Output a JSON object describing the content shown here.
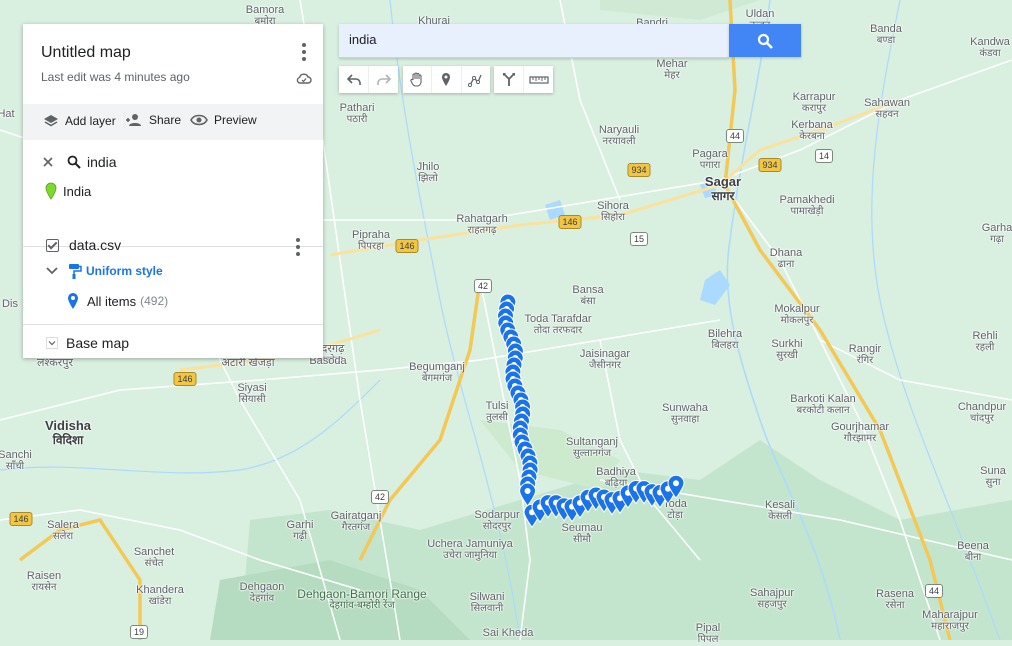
{
  "map": {
    "places": [
      {
        "name": "Bamora",
        "native": "बमोरा"
      },
      {
        "name": "Khurai",
        "native": ""
      },
      {
        "name": "Bandri",
        "native": ""
      },
      {
        "name": "Uldan",
        "native": "उल्दन"
      },
      {
        "name": "Banda",
        "native": "बण्डा"
      },
      {
        "name": "Kandwa",
        "native": "कंडवा"
      },
      {
        "name": "Mehar",
        "native": "मेहर"
      },
      {
        "name": "Karrapur",
        "native": "करापुर"
      },
      {
        "name": "Sahawan",
        "native": "सहवन"
      },
      {
        "name": "Kerbana",
        "native": "केरबना"
      },
      {
        "name": "Pathari",
        "native": "पठारी"
      },
      {
        "name": "Naryauli",
        "native": "नरयावली"
      },
      {
        "name": "Pagara",
        "native": "पगारा"
      },
      {
        "name": "Sagar",
        "native": "सागर"
      },
      {
        "name": "Jhilo",
        "native": "झिलो"
      },
      {
        "name": "Pamakhedi",
        "native": "पामाखेड़ी"
      },
      {
        "name": "Sihora",
        "native": "सिहोरा"
      },
      {
        "name": "Rahatgarh",
        "native": "राहतगढ़"
      },
      {
        "name": "Garha",
        "native": "गढ़ा"
      },
      {
        "name": "Piprahа",
        "native": "पिपरहा"
      },
      {
        "name": "Dhana",
        "native": "ढाना"
      },
      {
        "name": "Bansa",
        "native": "बंसा"
      },
      {
        "name": "Toda Tarafdar",
        "native": "तोदा तरफदार"
      },
      {
        "name": "Mokalpur",
        "native": "मोकलपुर"
      },
      {
        "name": "Bilehra",
        "native": "बिलहरा"
      },
      {
        "name": "Rehli",
        "native": "रहली"
      },
      {
        "name": "Jaisinagar",
        "native": "जैसीनगर"
      },
      {
        "name": "Surkhi",
        "native": "सुरखी"
      },
      {
        "name": "Rangir",
        "native": "रंगिर"
      },
      {
        "name": "Begumganj",
        "native": "बेगमगंज"
      },
      {
        "name": "Basoda",
        "native": "बासोदा"
      },
      {
        "name": "Siyasi",
        "native": "सियासी"
      },
      {
        "name": "Barkoti Kalan",
        "native": "बरकोटी कलान"
      },
      {
        "name": "Chandpur",
        "native": "चांदपुर"
      },
      {
        "name": "Sunwaha",
        "native": "सुनवाहा"
      },
      {
        "name": "Vidisha",
        "native": "विदिशा"
      },
      {
        "name": "Tulsi",
        "native": "तुलसी"
      },
      {
        "name": "Gourjhamar",
        "native": "गौरझामर"
      },
      {
        "name": "Sultanganj",
        "native": "सुल्तानगंज"
      },
      {
        "name": "Suna",
        "native": "सुना"
      },
      {
        "name": "Sanchi",
        "native": "साँची"
      },
      {
        "name": "Badhiya",
        "native": "बढ़िया"
      },
      {
        "name": "Kesali",
        "native": "केसली"
      },
      {
        "name": "Salera",
        "native": "सलेरा"
      },
      {
        "name": "Garhi",
        "native": "गढ़ी"
      },
      {
        "name": "Gairatganj",
        "native": "गैरतगंज"
      },
      {
        "name": "Sodarpur",
        "native": "सोदरपुर"
      },
      {
        "name": "Seumau",
        "native": "सीमौ"
      },
      {
        "name": "Toda",
        "native": "टोड़ा"
      },
      {
        "name": "Sanchet",
        "native": "संचेत"
      },
      {
        "name": "Uchera Jamuniya",
        "native": "उचेरा जामुनिया"
      },
      {
        "name": "Beena",
        "native": "बीना"
      },
      {
        "name": "Raisen",
        "native": "रायसेन"
      },
      {
        "name": "Khandera",
        "native": "खांडेरा"
      },
      {
        "name": "Dehgaon",
        "native": "देहगांव"
      },
      {
        "name": "Sahajpur",
        "native": "सहजपुर"
      },
      {
        "name": "Rasena",
        "native": "रसेना"
      },
      {
        "name": "Dehgaon-Bamori Range",
        "native": "देहगांव-बम्होरी रेंज"
      },
      {
        "name": "Silwani",
        "native": "सिलवानी"
      },
      {
        "name": "Maharajpur",
        "native": "महाराजपुर"
      },
      {
        "name": "Sai Kheda",
        "native": ""
      },
      {
        "name": "Pipal",
        "native": "पिपल"
      },
      {
        "name": "Atari Khejda",
        "native": "अटारी खेजड़ा"
      },
      {
        "name": "Lashkarpur",
        "native": "लश्करपुर"
      },
      {
        "name": "Gergarh",
        "native": "हैदरगढ़"
      },
      {
        "name": "Dis",
        "native": ""
      },
      {
        "name": "Hat",
        "native": ""
      }
    ],
    "highways": [
      "44",
      "934",
      "14",
      "146",
      "15",
      "42",
      "146",
      "146",
      "42",
      "146",
      "19",
      "44",
      "934"
    ]
  },
  "panel": {
    "title": "Untitled map",
    "last_edit": "Last edit was 4 minutes ago",
    "actions": {
      "add_layer": "Add layer",
      "share": "Share",
      "preview": "Preview"
    },
    "search_layer": {
      "query": "india",
      "result": "India",
      "result_color": "#7cda2c"
    },
    "data_layer": {
      "name": "data.csv",
      "style": "Uniform style",
      "items_label": "All items",
      "items_count": "(492)"
    },
    "base_map": "Base map"
  },
  "search": {
    "value": "india",
    "button_color": "#4285f4"
  },
  "colors": {
    "marker": "#1a73e8",
    "water": "#aadaff",
    "land": "#d9efe0",
    "forest": "#c0e3ca"
  },
  "markers": {
    "count": 492
  }
}
